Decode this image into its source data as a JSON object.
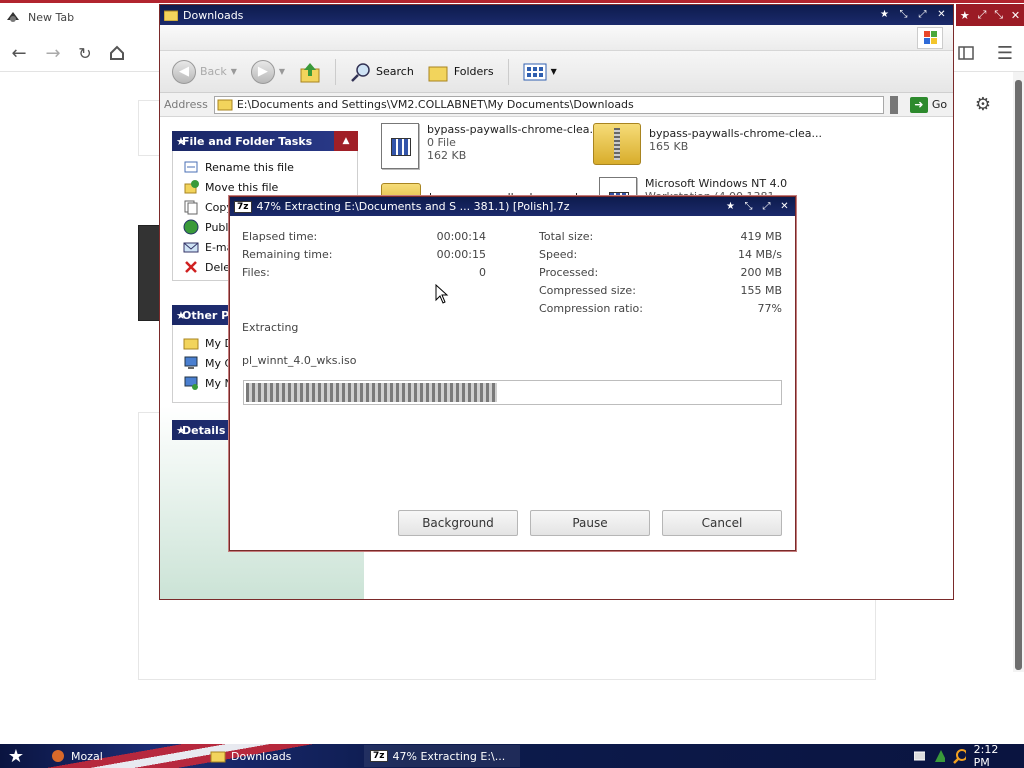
{
  "browser": {
    "tab_title": "New Tab",
    "win_controls": [
      "★",
      "⤢",
      "⤡",
      "✕"
    ]
  },
  "explorer": {
    "title": "Downloads",
    "toolbar": {
      "back_label": "Back",
      "search_label": "Search",
      "folders_label": "Folders"
    },
    "address": {
      "label": "Address",
      "path": "E:\\Documents and Settings\\VM2.COLLABNET\\My Documents\\Downloads",
      "go_label": "Go"
    },
    "tasks": {
      "file_header": "File and Folder Tasks",
      "items": [
        "Rename this file",
        "Move this file",
        "Copy",
        "Publ",
        "E-ma",
        "Dele"
      ],
      "other_header": "Other P",
      "other_items": [
        "My D",
        "My C",
        "My N"
      ],
      "details_header": "Details"
    },
    "files": [
      {
        "name": "bypass-paywalls-chrome-clea...",
        "type": "0 File",
        "size": "162 KB"
      },
      {
        "name": "bypass-paywalls-chrome-clea...",
        "size": "165 KB"
      },
      {
        "name": "bypass-paywalls-chrome-clea..."
      },
      {
        "name": "Microsoft Windows NT 4.0",
        "sub": "Workstation (4.00.1381..."
      }
    ]
  },
  "dialog": {
    "title": "47% Extracting E:\\Documents and S ... 381.1) [Polish].7z",
    "badge": "7z",
    "left_stats": [
      {
        "label": "Elapsed time:",
        "value": "00:00:14"
      },
      {
        "label": "Remaining time:",
        "value": "00:00:15"
      },
      {
        "label": "Files:",
        "value": "0"
      }
    ],
    "right_stats": [
      {
        "label": "Total size:",
        "value": "419 MB"
      },
      {
        "label": "Speed:",
        "value": "14 MB/s"
      },
      {
        "label": "Processed:",
        "value": "200 MB"
      },
      {
        "label": "Compressed size:",
        "value": "155 MB"
      },
      {
        "label": "Compression ratio:",
        "value": "77%"
      }
    ],
    "status": "Extracting",
    "current_file": "pl_winnt_4.0_wks.iso",
    "progress": 0.47,
    "buttons": {
      "background": "Background",
      "pause": "Pause",
      "cancel": "Cancel"
    }
  },
  "taskbar": {
    "items": [
      "Mozal",
      "Downloads",
      "47% Extracting E:\\..."
    ],
    "clock": "2:12 PM"
  },
  "colors": {
    "title_bar": "#0d1b4d",
    "accent_red": "#a01f27",
    "progress": "#7a7a7a"
  }
}
